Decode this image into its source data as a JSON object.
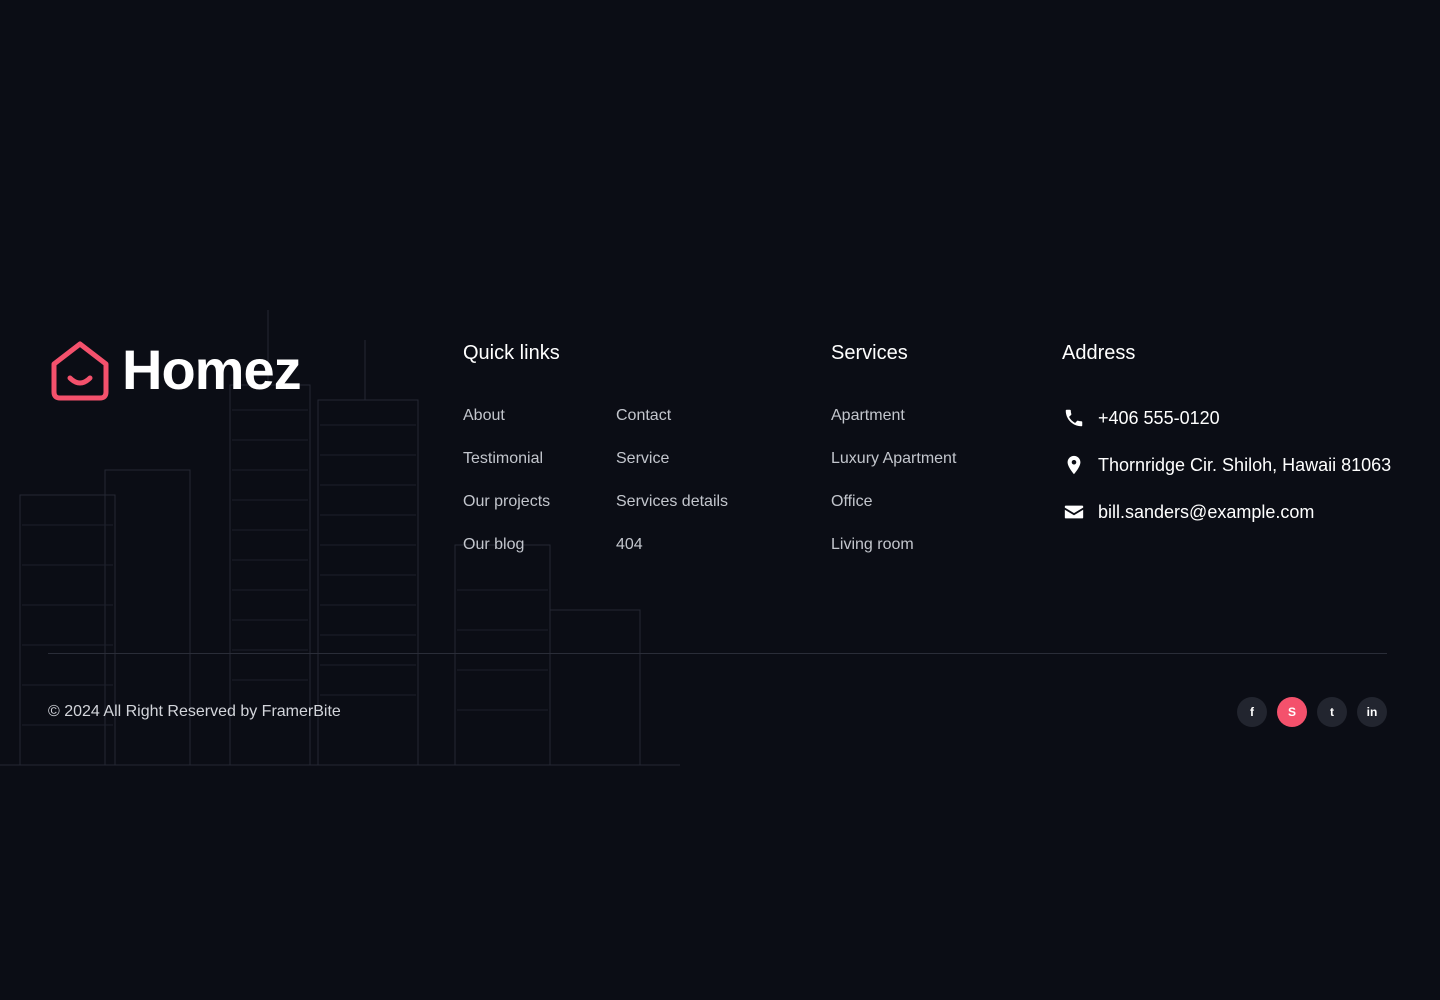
{
  "brand": {
    "name": "Homez",
    "accent_color": "#f4516c"
  },
  "quick_links": {
    "title": "Quick links",
    "col1": [
      "About",
      "Testimonial",
      "Our projects",
      "Our blog"
    ],
    "col2": [
      "Contact",
      "Service",
      "Services details",
      "404"
    ]
  },
  "services": {
    "title": "Services",
    "items": [
      "Apartment",
      "Luxury Apartment",
      "Office",
      "Living room"
    ]
  },
  "address": {
    "title": "Address",
    "phone": "+406 555-0120",
    "location": "Thornridge Cir. Shiloh, Hawaii 81063",
    "email": "bill.sanders@example.com"
  },
  "copyright": "© 2024 All Right Reserved by FramerBite",
  "socials": [
    {
      "name": "facebook",
      "glyph": "f",
      "active": false
    },
    {
      "name": "skype",
      "glyph": "S",
      "active": true
    },
    {
      "name": "twitter",
      "glyph": "t",
      "active": false
    },
    {
      "name": "linkedin",
      "glyph": "in",
      "active": false
    }
  ]
}
